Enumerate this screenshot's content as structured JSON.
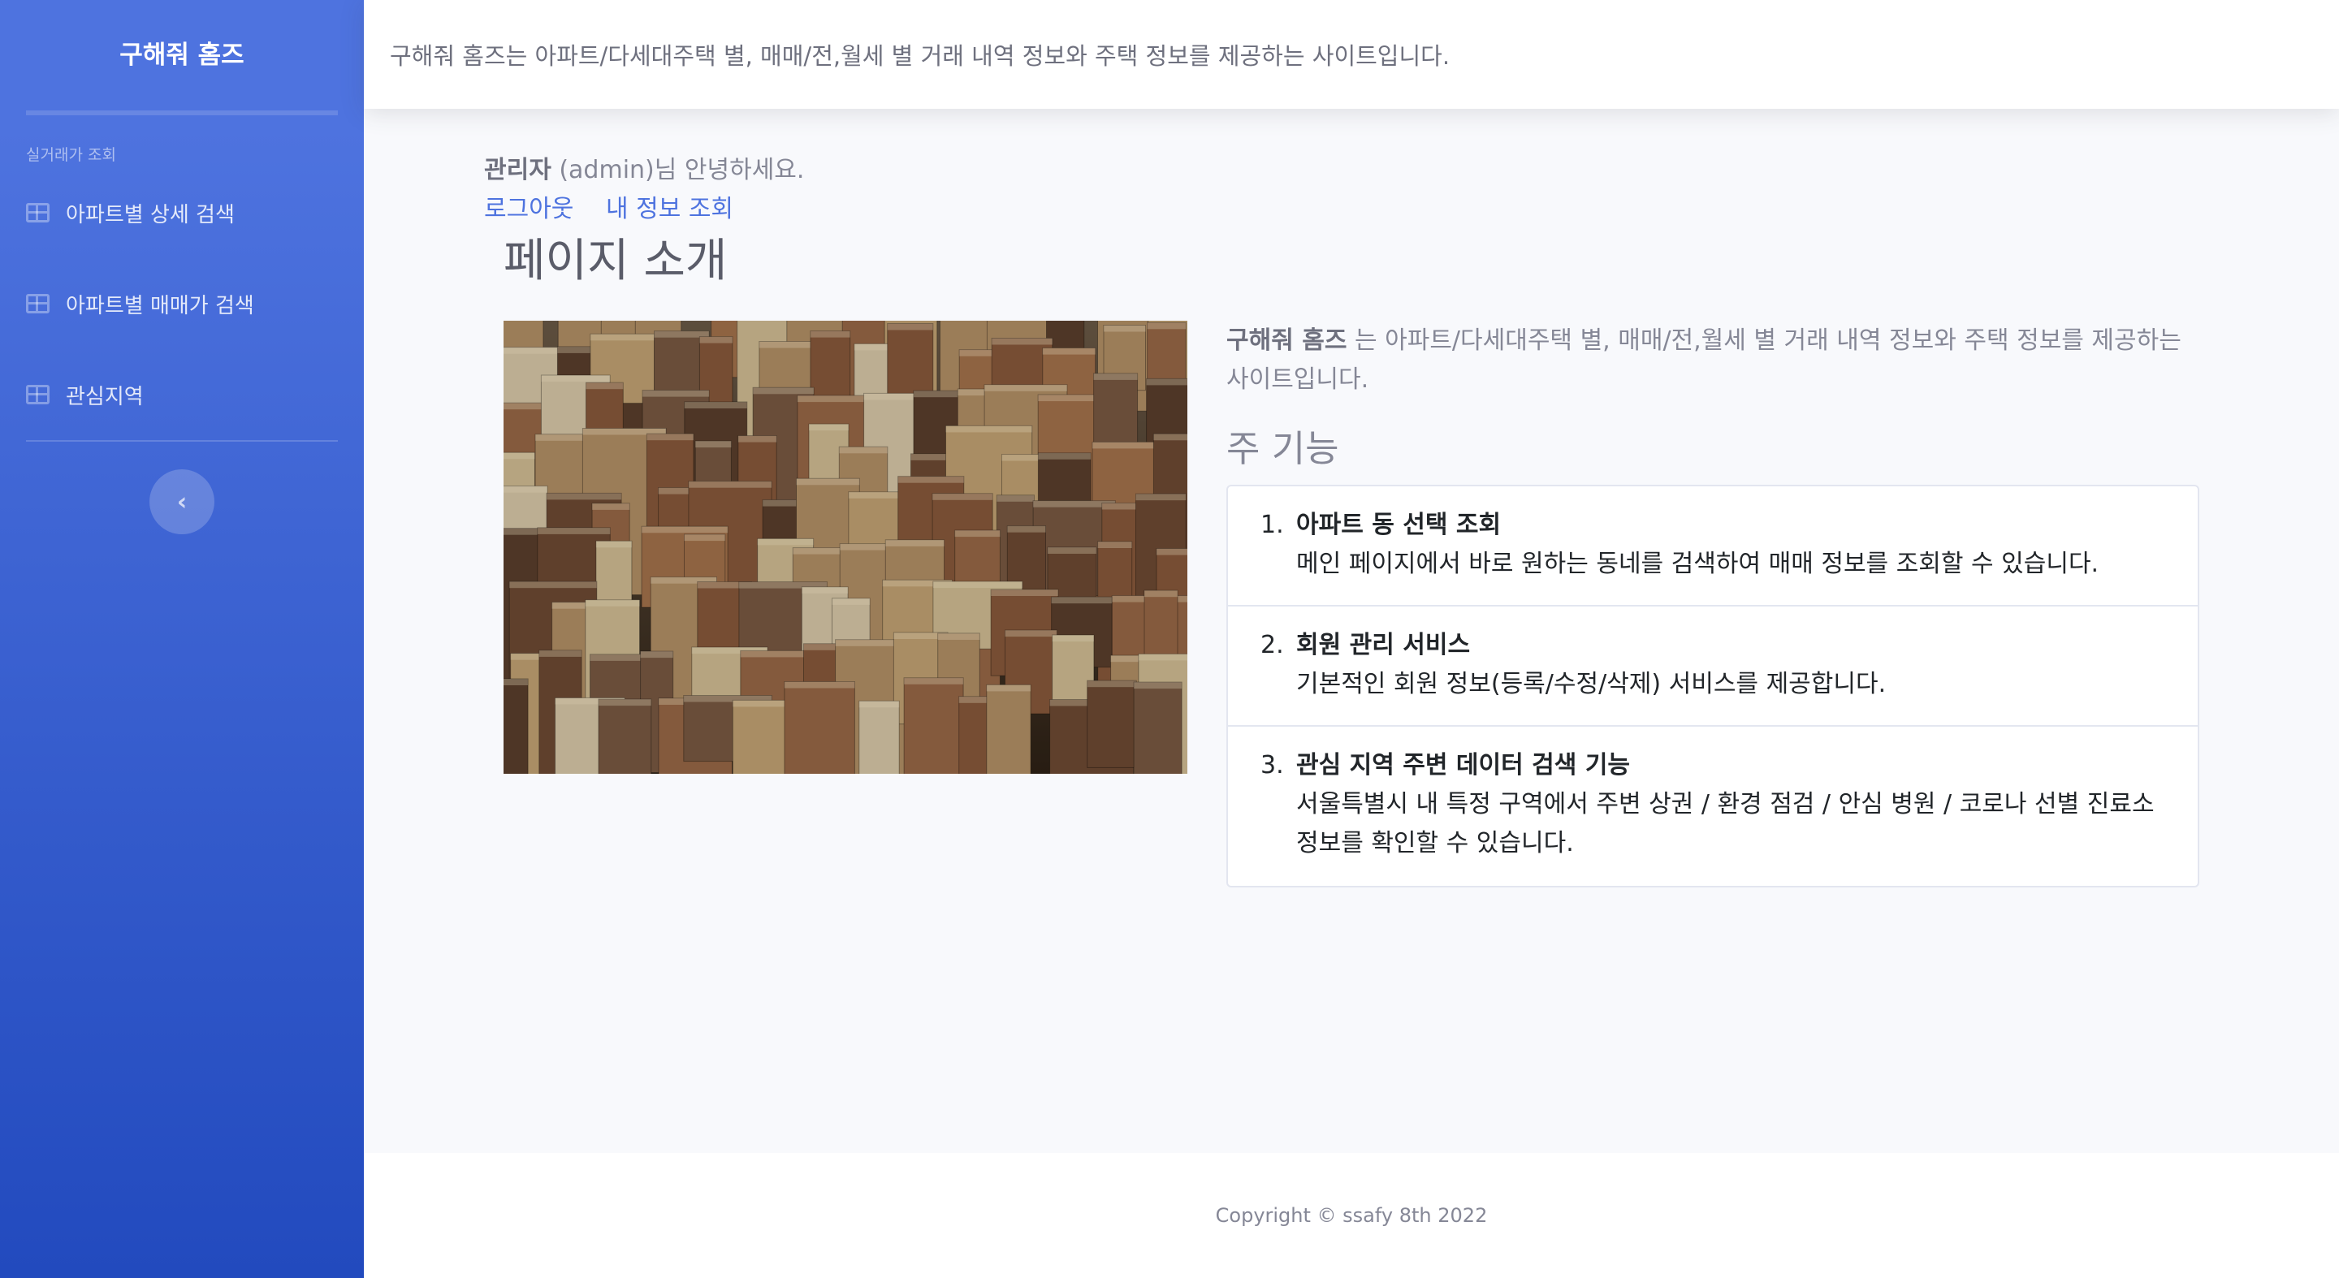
{
  "sidebar": {
    "brand": "구해줘 홈즈",
    "heading": "실거래가 조회",
    "items": [
      {
        "label": "아파트별 상세 검색",
        "icon": "table-icon"
      },
      {
        "label": "아파트별 매매가 검색",
        "icon": "table-icon"
      },
      {
        "label": "관심지역",
        "icon": "table-icon"
      }
    ],
    "toggle_glyph": "‹"
  },
  "topbar": {
    "text": "구해줘 홈즈는 아파트/다세대주택 별, 매매/전,월세 별 거래 내역 정보와 주택 정보를 제공하는 사이트입니다."
  },
  "user": {
    "name": "관리자",
    "greeting_suffix": " (admin)님 안녕하세요.",
    "logout": "로그아웃",
    "my_info": "내 정보 조회"
  },
  "main": {
    "title": "페이지 소개",
    "image_alt": "city aerial photo",
    "intro_brand": "구해줘 홈즈",
    "intro_text": " 는 아파트/다세대주택 별, 매매/전,월세 별 거래 내역 정보와 주택 정보를 제공하는 사이트입니다.",
    "features_heading": "주 기능",
    "features": [
      {
        "num": "1.",
        "title": "아파트 동 선택 조회",
        "desc": "메인 페이지에서 바로 원하는 동네를 검색하여 매매 정보를 조회할 수 있습니다."
      },
      {
        "num": "2.",
        "title": "회원 관리 서비스",
        "desc": "기본적인 회원 정보(등록/수정/삭제) 서비스를 제공합니다."
      },
      {
        "num": "3.",
        "title": "관심 지역 주변 데이터 검색 기능",
        "desc": "서울특별시 내 특정 구역에서 주변 상권 / 환경 점검 / 안심 병원 / 코로나 선별 진료소 정보를 확인할 수 있습니다."
      }
    ]
  },
  "footer": {
    "text": "Copyright © ssafy 8th 2022"
  },
  "colors": {
    "sidebar_top": "#4e73df",
    "sidebar_bottom": "#224abe",
    "link": "#4e73df",
    "background": "#f8f9fc"
  }
}
